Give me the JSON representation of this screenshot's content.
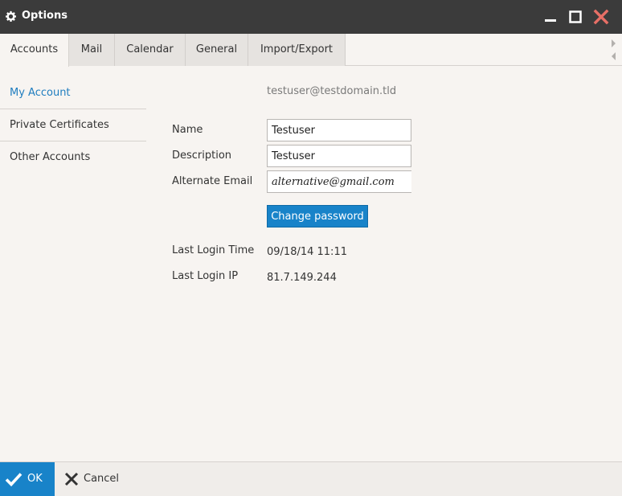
{
  "window": {
    "title": "Options",
    "icon": "gear-icon"
  },
  "tabs": [
    {
      "label": "Accounts",
      "active": true
    },
    {
      "label": "Mail"
    },
    {
      "label": "Calendar"
    },
    {
      "label": "General"
    },
    {
      "label": "Import/Export"
    }
  ],
  "sidebar": {
    "items": [
      {
        "label": "My Account",
        "active": true
      },
      {
        "label": "Private Certificates"
      },
      {
        "label": "Other Accounts"
      }
    ]
  },
  "account": {
    "email": "testuser@testdomain.tld",
    "name_label": "Name",
    "name_value": "Testuser",
    "description_label": "Description",
    "description_value": "Testuser",
    "alt_email_label": "Alternate Email",
    "alt_email_value": "alternative@gmail.com",
    "change_password_label": "Change password",
    "last_login_time_label": "Last Login Time",
    "last_login_time_value": "09/18/14 11:11",
    "last_login_ip_label": "Last Login IP",
    "last_login_ip_value": "81.7.149.244"
  },
  "footer": {
    "ok_label": "OK",
    "cancel_label": "Cancel"
  },
  "colors": {
    "accent": "#1883c9",
    "titlebar": "#3b3b3b",
    "close": "#e76f66",
    "link": "#1f7dbf"
  }
}
